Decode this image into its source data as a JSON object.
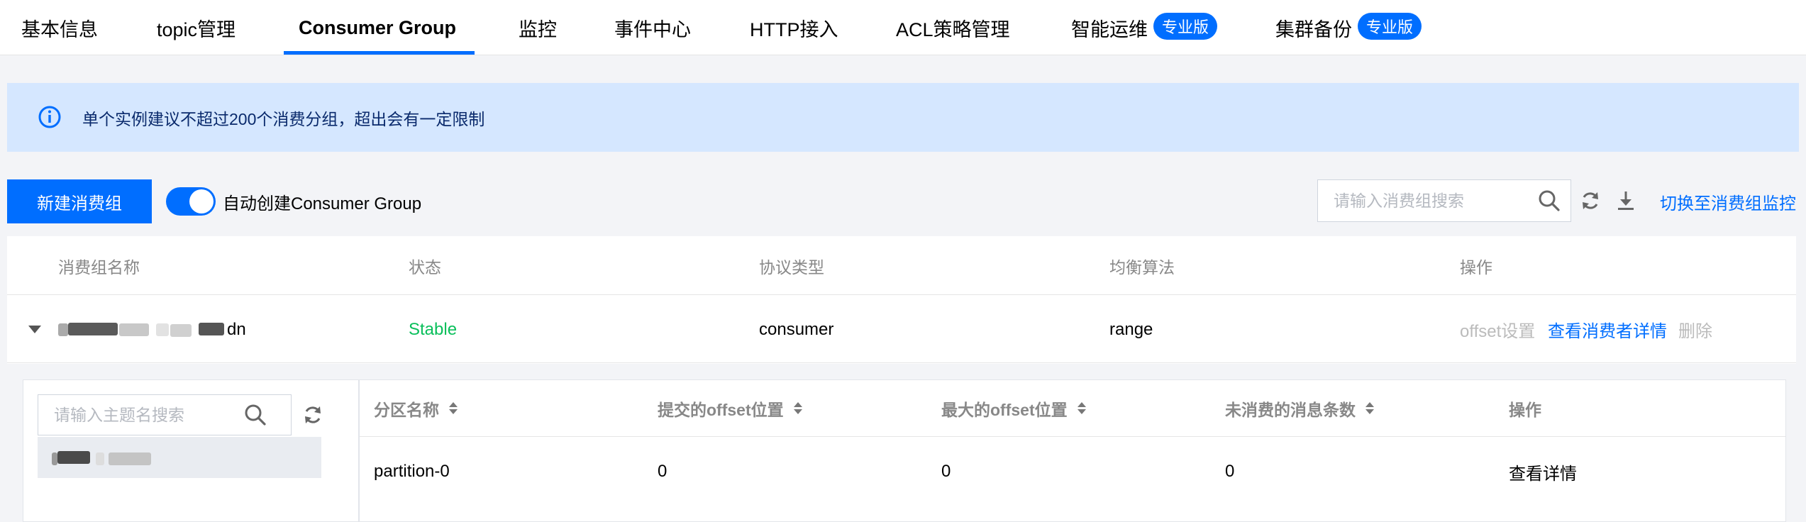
{
  "tabs": [
    {
      "label": "基本信息"
    },
    {
      "label": "topic管理"
    },
    {
      "label": "Consumer Group"
    },
    {
      "label": "监控"
    },
    {
      "label": "事件中心"
    },
    {
      "label": "HTTP接入"
    },
    {
      "label": "ACL策略管理"
    },
    {
      "label": "智能运维"
    },
    {
      "label": "集群备份"
    }
  ],
  "active_tab": "Consumer Group",
  "pro_badge": "专业版",
  "banner": {
    "text": "单个实例建议不超过200个消费分组，超出会有一定限制"
  },
  "toolbar": {
    "create_button": "新建消费组",
    "auto_create_label": "自动创建Consumer Group",
    "auto_create_enabled": true,
    "search_placeholder": "请输入消费组搜索",
    "switch_monitor_link": "切换至消费组监控"
  },
  "table": {
    "columns": [
      "消费组名称",
      "状态",
      "协议类型",
      "均衡算法",
      "操作"
    ],
    "rows": [
      {
        "name_visible": "dn",
        "status": "Stable",
        "protocol": "consumer",
        "balance": "range",
        "ops": {
          "offset": "offset设置",
          "detail": "查看消费者详情",
          "delete": "删除"
        }
      }
    ]
  },
  "expanded": {
    "topic_search_placeholder": "请输入主题名搜索",
    "columns": [
      "分区名称",
      "提交的offset位置",
      "最大的offset位置",
      "未消费的消息条数",
      "操作"
    ],
    "rows": [
      {
        "partition": "partition-0",
        "committed": "0",
        "max": "0",
        "unconsumed": "0",
        "action": "查看详情"
      }
    ]
  },
  "colors": {
    "accent": "#006eff",
    "stable": "#0abf5b",
    "banner_bg": "#d5e7ff"
  }
}
